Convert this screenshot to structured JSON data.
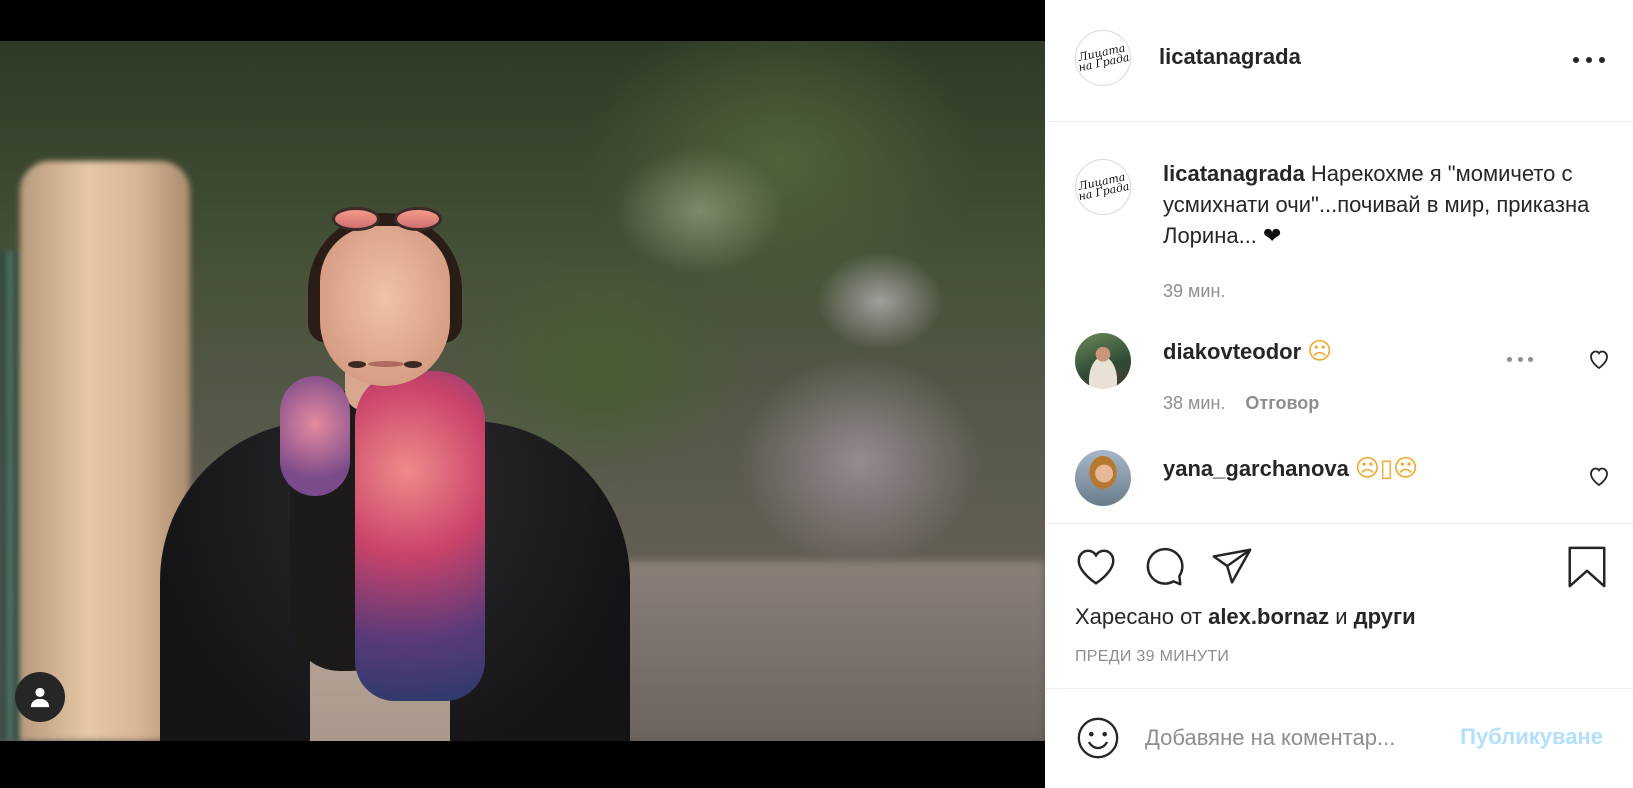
{
  "post": {
    "username": "licatanagrada",
    "logo_text": "Лицата на Града",
    "caption": "Нарекохме я \"момичето с усмихнати очи\"...почивай в мир, приказна Лорина...",
    "caption_emoji": "❤",
    "caption_time": "39 мин."
  },
  "comments": [
    {
      "username": "diakovteodor",
      "text": "☹",
      "time": "38 мин.",
      "reply_label": "Отговор"
    },
    {
      "username": "yana_garchanova",
      "text": "☹▯☹",
      "time": "",
      "reply_label": ""
    }
  ],
  "actions": {
    "liked_prefix": "Харесано от",
    "liked_user": "alex.bornaz",
    "liked_and": "и",
    "liked_others": "други",
    "post_time": "ПРЕДИ 39 МИНУТИ"
  },
  "comment_box": {
    "placeholder": "Добавяне на коментар...",
    "publish_label": "Публикуване"
  },
  "colors": {
    "text": "#262626",
    "secondary": "#8e8e8e",
    "publish_disabled": "#b2dffc",
    "border": "#efefef"
  },
  "icons": [
    "more-icon",
    "heart-icon",
    "comment-icon",
    "share-icon",
    "bookmark-icon",
    "emoji-icon",
    "user-icon"
  ]
}
